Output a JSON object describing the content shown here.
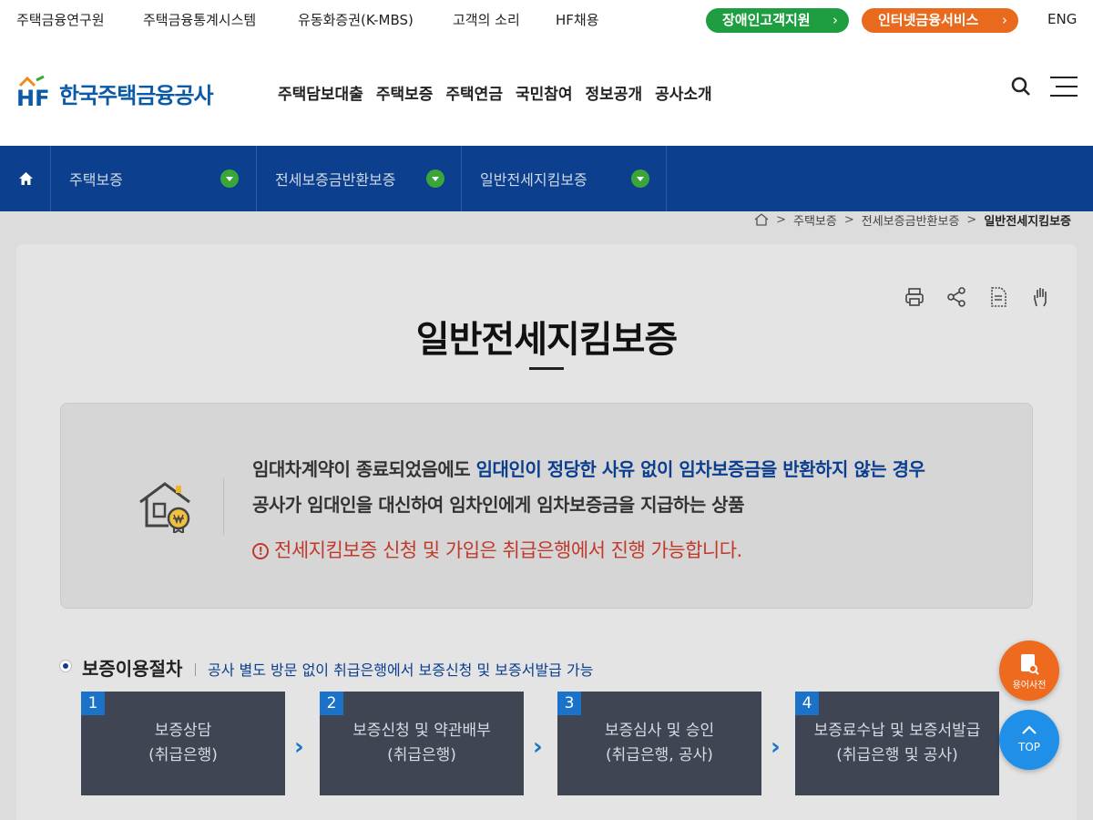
{
  "util": {
    "links": [
      "주택금융연구원",
      "주택금융통계시스템",
      "유동화증권(K-MBS)",
      "고객의 소리",
      "HF채용"
    ],
    "accessibility_button": "장애인고객지원",
    "internet_button": "인터넷금융서비스",
    "chevron": "›",
    "lang": "ENG"
  },
  "header": {
    "logo_mark": "HF",
    "logo_text": "한국주택금융공사",
    "gnb": [
      "주택담보대출",
      "주택보증",
      "주택연금",
      "국민참여",
      "정보공개",
      "공사소개"
    ]
  },
  "lnb": {
    "items": [
      "주택보증",
      "전세보증금반환보증",
      "일반전세지킴보증"
    ]
  },
  "breadcrumb": {
    "items": [
      "주택보증",
      "전세보증금반환보증"
    ],
    "current": "일반전세지킴보증",
    "separator": ">"
  },
  "page": {
    "title": "일반전세지킴보증"
  },
  "intro": {
    "line1_plain": "임대차계약이 종료되었음에도 ",
    "line1_highlight": "임대인이 정당한 사유 없이 임차보증금을 반환하지 않는 경우",
    "line2": "공사가 임대인을 대신하여 임차인에게 임차보증금을 지급하는 상품",
    "notice_icon": "!",
    "notice": "전세지킴보증 신청 및 가입은 취급은행에서 진행 가능합니다."
  },
  "procedure": {
    "title": "보증이용절차",
    "description": "공사 별도 방문 없이 취급은행에서 보증신청 및 보증서발급 가능",
    "steps": [
      {
        "num": "1",
        "title": "보증상담",
        "sub": "(취급은행)"
      },
      {
        "num": "2",
        "title": "보증신청 및 약관배부",
        "sub": "(취급은행)"
      },
      {
        "num": "3",
        "title": "보증심사 및 승인",
        "sub": "(취급은행, 공사)"
      },
      {
        "num": "4",
        "title": "보증료수납 및 보증서발급",
        "sub": "(취급은행 및 공사)"
      }
    ],
    "arrow": "›"
  },
  "floating": {
    "dictionary": "용어사전",
    "top": "TOP"
  },
  "colors": {
    "brand_blue": "#0c3f8d",
    "accent_green": "#1e9e41",
    "accent_orange": "#ea6a1d",
    "notice_red": "#c0392b",
    "step_bg": "#3f4553"
  }
}
